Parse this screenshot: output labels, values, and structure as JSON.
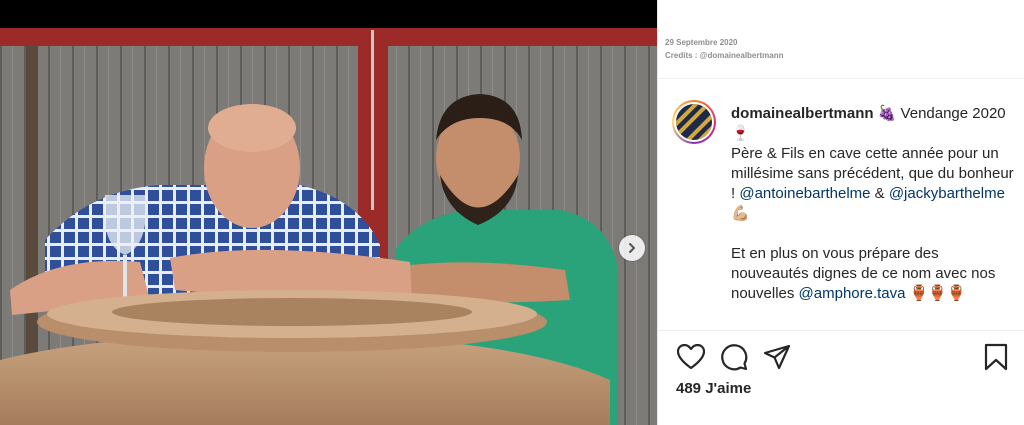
{
  "meta": {
    "date": "29 Septembre 2020",
    "credits": "Credits : @domainealbertmann"
  },
  "post": {
    "username": "domainealbertmann",
    "line1": " 🍇 Vendange 2020 🍷",
    "line2": "Père & Fils en cave cette année pour un millésime sans précédent, que du bonheur ! ",
    "mention1": "@antoinebarthelme",
    "amp": " & ",
    "mention2": "@jackybarthelme",
    "emoji_muscle": " 💪🏼",
    "line3": "Et en plus on vous prépare des nouveautés dignes de ce nom avec nos nouvelles ",
    "mention3": "@amphore.tava",
    "emoji_amphora": " 🏺🏺🏺",
    "likes": "489 J'aime"
  },
  "icons": {
    "like": "heart-icon",
    "comment": "comment-icon",
    "share": "share-icon",
    "save": "bookmark-icon",
    "next": "chevron-right-icon"
  },
  "colors": {
    "mention": "#00376b",
    "text": "#262626",
    "muted": "#8e8e8e"
  }
}
